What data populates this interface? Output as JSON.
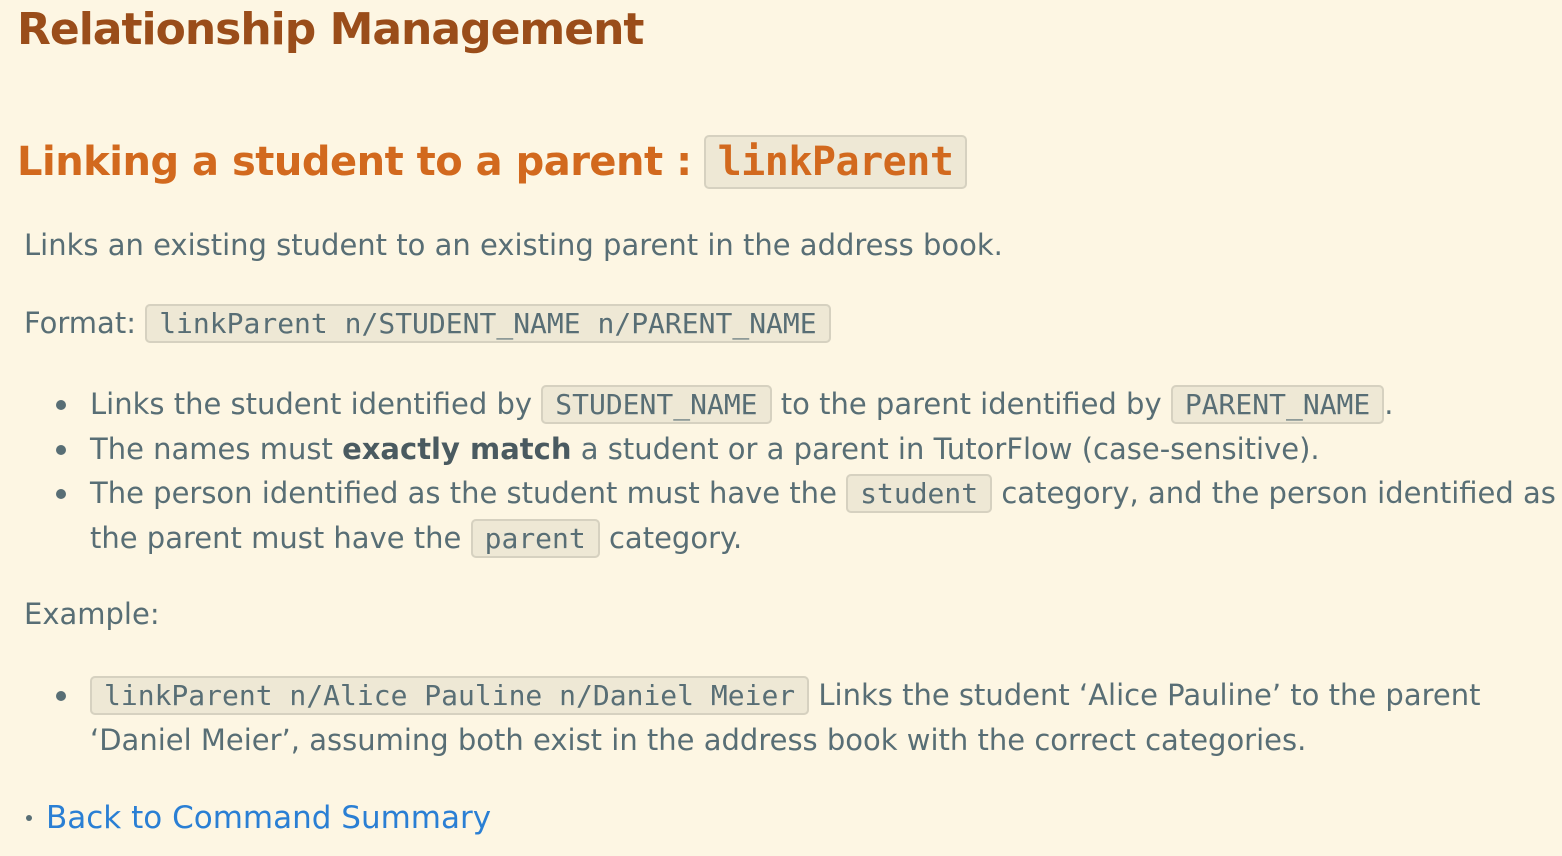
{
  "page_title": "Relationship Management",
  "section": {
    "heading_text": "Linking a student to a parent :",
    "heading_code": "linkParent",
    "description": "Links an existing student to an existing parent in the address book.",
    "format_label": "Format:",
    "format_code": "linkParent n/STUDENT_NAME n/PARENT_NAME",
    "bullets": {
      "b1": {
        "t1": "Links the student identified by",
        "c1": "STUDENT_NAME",
        "t2": "to the parent identified by",
        "c2": "PARENT_NAME",
        "t3": "."
      },
      "b2": {
        "t1": "The names must",
        "strong": "exactly match",
        "t2": "a student or a parent in TutorFlow (case-sensitive)."
      },
      "b3": {
        "t1": "The person identified as the student must have the",
        "c1": "student",
        "t2": "category, and the person identified as",
        "t3": "the parent must have the",
        "c2": "parent",
        "t4": "category."
      }
    },
    "example_label": "Example:",
    "example": {
      "code": "linkParent n/Alice Pauline n/Daniel Meier",
      "t1": "Links the student ‘Alice Pauline’ to the parent",
      "t2": "‘Daniel Meier’, assuming both exist in the address book with the correct categories."
    }
  },
  "back_link": "Back to Command Summary",
  "colors": {
    "background": "#fdf6e3",
    "title": "#9a4d1a",
    "heading": "#d2691e",
    "text": "#586e75",
    "link": "#2a7fd4"
  }
}
